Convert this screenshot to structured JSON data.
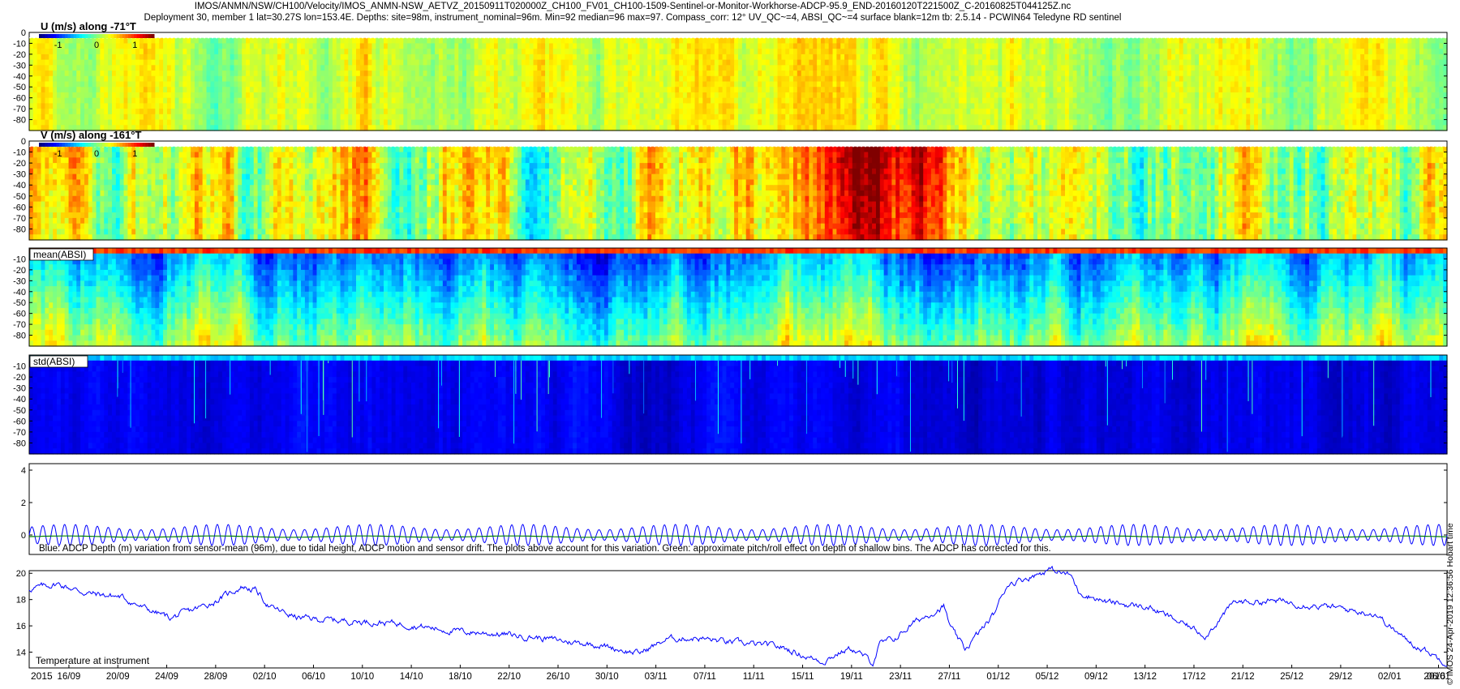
{
  "header": {
    "line1": "IMOS/ANMN/NSW/CH100/Velocity/IMOS_ANMN-NSW_AETVZ_20150911T020000Z_CH100_FV01_CH100-1509-Sentinel-or-Monitor-Workhorse-ADCP-95.9_END-20160120T221500Z_C-20160825T044125Z.nc",
    "line2": "Deployment 30, member 1 lat=30.27S lon=153.4E. Depths: site=98m, instrument_nominal=96m. Min=92 median=96 max=97. Compass_corr: 12° UV_QC~=4, ABSI_QC~=4 surface blank=12m tb: 2.5.14 - PCWIN64 Teledyne RD sentinel"
  },
  "side_text": "© IMOS 24-Apr-2019 12:36:56 Hobart time",
  "chart_data": [
    {
      "type": "heatmap",
      "title": "U (m/s) along -71°T",
      "yticks": [
        0,
        -10,
        -20,
        -30,
        -40,
        -50,
        -60,
        -70,
        -80
      ],
      "ylim": [
        -90,
        0
      ],
      "colorbar": {
        "ticks": [
          "-1",
          "0",
          "1"
        ],
        "range": [
          -1.5,
          1.5
        ]
      },
      "description_values": {
        "surface_blank_m": -10,
        "typical_value": 0.0
      },
      "base": 0.58,
      "amp": 0.07,
      "events": []
    },
    {
      "type": "heatmap",
      "title": "V (m/s) along -161°T",
      "yticks": [
        0,
        -10,
        -20,
        -30,
        -40,
        -50,
        -60,
        -70,
        -80
      ],
      "ylim": [
        -90,
        0
      ],
      "colorbar": {
        "ticks": [
          "-1",
          "0",
          "1"
        ],
        "range": [
          -1.5,
          1.5
        ]
      },
      "base": 0.56,
      "amp": 0.13,
      "events": [
        [
          0.02,
          0.03,
          0.27
        ],
        [
          0.23,
          0.02,
          0.14
        ],
        [
          0.32,
          0.025,
          0.18
        ],
        [
          0.45,
          0.02,
          0.12
        ],
        [
          0.5,
          0.025,
          0.16
        ],
        [
          0.53,
          0.015,
          0.1
        ],
        [
          0.585,
          0.045,
          0.3
        ],
        [
          0.635,
          0.03,
          0.25
        ],
        [
          0.69,
          0.02,
          0.12
        ],
        [
          0.75,
          0.02,
          0.12
        ],
        [
          0.2,
          0.01,
          -0.15
        ],
        [
          0.94,
          0.02,
          0.12
        ]
      ]
    },
    {
      "type": "heatmap",
      "title": "mean(ABSI)",
      "yticks": [
        -10,
        -20,
        -30,
        -40,
        -50,
        -60,
        -70,
        -80
      ],
      "ylim": [
        -90,
        0
      ],
      "base": 0.42,
      "amp": 0.1,
      "depth_gradient": 0.3,
      "events": [
        [
          0.42,
          0.04,
          -0.08
        ],
        [
          0.65,
          0.05,
          -0.1
        ],
        [
          0.07,
          0.03,
          -0.06
        ]
      ]
    },
    {
      "type": "heatmap",
      "title": "std(ABSI)",
      "yticks": [
        -10,
        -20,
        -30,
        -40,
        -50,
        -60,
        -70,
        -80
      ],
      "ylim": [
        -90,
        0
      ],
      "base": 0.1,
      "amp": 0.03,
      "events": []
    },
    {
      "type": "line",
      "title": "",
      "annotation": "Blue: ADCP Depth (m) variation from sensor-mean (96m), due to tidal height, ADCP motion and sensor drift. The plots above account for this variation. Green: approximate pitch/roll effect on depth of shallow bins. The ADCP has corrected for this.",
      "yticks": [
        0,
        2,
        4
      ],
      "ylim": [
        -1.2,
        4.4
      ],
      "series": [
        {
          "color": "#0000ff",
          "kind": "tidal",
          "mean": 0.0,
          "amplitude": 0.65,
          "cycles": 130
        },
        {
          "color": "#008000",
          "kind": "flat",
          "mean": -0.1
        }
      ]
    },
    {
      "type": "line",
      "title": "",
      "annotation": "Temperature at instrument",
      "yticks": [
        14,
        16,
        18,
        20
      ],
      "ylim": [
        12.8,
        20.2
      ],
      "series": [
        {
          "color": "#0000ff",
          "x": [
            0,
            0.02,
            0.04,
            0.065,
            0.08,
            0.1,
            0.13,
            0.15,
            0.16,
            0.17,
            0.19,
            0.22,
            0.26,
            0.3,
            0.33,
            0.36,
            0.38,
            0.4,
            0.43,
            0.45,
            0.47,
            0.49,
            0.53,
            0.55,
            0.56,
            0.57,
            0.58,
            0.595,
            0.6,
            0.61,
            0.625,
            0.645,
            0.65,
            0.66,
            0.68,
            0.69,
            0.71,
            0.72,
            0.735,
            0.74,
            0.76,
            0.79,
            0.83,
            0.85,
            0.88,
            0.92,
            0.95,
            0.97,
            0.99,
            1.0
          ],
          "y": [
            18.8,
            19.2,
            18.5,
            18.2,
            17.4,
            16.6,
            17.8,
            19.0,
            18.7,
            17.4,
            16.6,
            16.4,
            16.2,
            15.6,
            15.4,
            15.1,
            14.8,
            14.6,
            13.9,
            15.0,
            15.1,
            14.8,
            14.4,
            13.6,
            13.3,
            13.9,
            14.3,
            13.2,
            14.6,
            15.0,
            16.3,
            17.5,
            15.8,
            14.2,
            16.8,
            19.2,
            19.9,
            20.3,
            19.8,
            18.6,
            17.8,
            17.4,
            15.3,
            17.8,
            17.9,
            17.4,
            16.9,
            15.0,
            13.8,
            13.2
          ]
        }
      ]
    }
  ],
  "x_axis": {
    "labels": [
      "2015",
      "16/09",
      "20/09",
      "24/09",
      "28/09",
      "02/10",
      "06/10",
      "10/10",
      "14/10",
      "18/10",
      "22/10",
      "26/10",
      "30/10",
      "03/11",
      "07/11",
      "11/11",
      "15/11",
      "19/11",
      "23/11",
      "27/11",
      "01/12",
      "05/12",
      "09/12",
      "13/12",
      "17/12",
      "21/12",
      "25/12",
      "29/12",
      "02/01",
      "06/01",
      "10/01",
      "14/01",
      "2016"
    ],
    "positions": [
      0.0,
      0.028,
      0.063,
      0.098,
      0.132,
      0.167,
      0.202,
      0.236,
      0.271,
      0.306,
      0.34,
      0.375,
      0.41,
      0.444,
      0.479,
      0.514,
      0.548,
      0.583,
      0.618,
      0.653,
      0.687,
      0.722,
      0.757,
      0.791,
      0.826,
      0.861,
      0.895,
      0.93,
      0.964,
      0.999,
      1.0,
      1.0,
      1.0
    ]
  }
}
